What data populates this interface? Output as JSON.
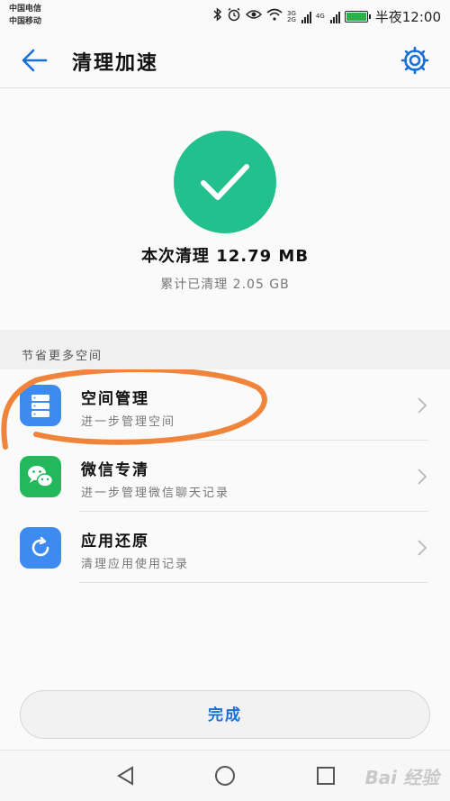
{
  "status_bar": {
    "carriers": [
      "中国电信",
      "中国移动"
    ],
    "net_1": [
      "3G",
      "2G"
    ],
    "net_2": "4G",
    "time": "半夜12:00"
  },
  "header": {
    "title": "清理加速",
    "back_icon": "arrow-left-icon",
    "settings_icon": "gear-icon"
  },
  "result": {
    "icon": "checkmark-icon",
    "summary": "本次清理 12.79 MB",
    "total": "累计已清理 2.05 GB"
  },
  "section": {
    "title": "节省更多空间"
  },
  "items": [
    {
      "title": "空间管理",
      "subtitle": "进一步管理空间",
      "icon": "storage-icon"
    },
    {
      "title": "微信专清",
      "subtitle": "进一步管理微信聊天记录",
      "icon": "wechat-icon"
    },
    {
      "title": "应用还原",
      "subtitle": "清理应用使用记录",
      "icon": "restore-icon"
    }
  ],
  "done_button": "完成",
  "nav": {
    "back": "triangle-back-icon",
    "home": "circle-home-icon",
    "recent": "square-recent-icon"
  },
  "watermark": "Bai 经验",
  "colors": {
    "accent": "#1a6fd6",
    "success": "#21c08c",
    "annotation": "#f0843a"
  }
}
